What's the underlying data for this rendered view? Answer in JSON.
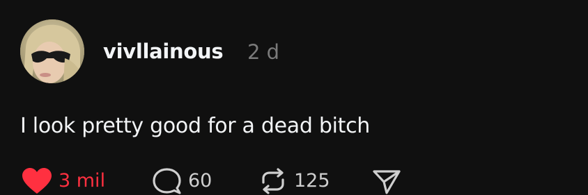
{
  "post": {
    "username": "vivllainous",
    "timestamp": "2 d",
    "text": "I look pretty good for a dead bitch",
    "avatar_icon": "profile-photo"
  },
  "actions": {
    "like": {
      "icon": "heart-filled-icon",
      "count": "3 mil",
      "color": "#ff3040",
      "liked": true
    },
    "reply": {
      "icon": "speech-bubble-icon",
      "count": "60"
    },
    "repost": {
      "icon": "repost-arrows-icon",
      "count": "125"
    },
    "share": {
      "icon": "paper-plane-icon"
    }
  },
  "colors": {
    "background": "#101010",
    "text": "#f3f5f7",
    "muted": "#7a7a7a",
    "like": "#ff3040"
  }
}
